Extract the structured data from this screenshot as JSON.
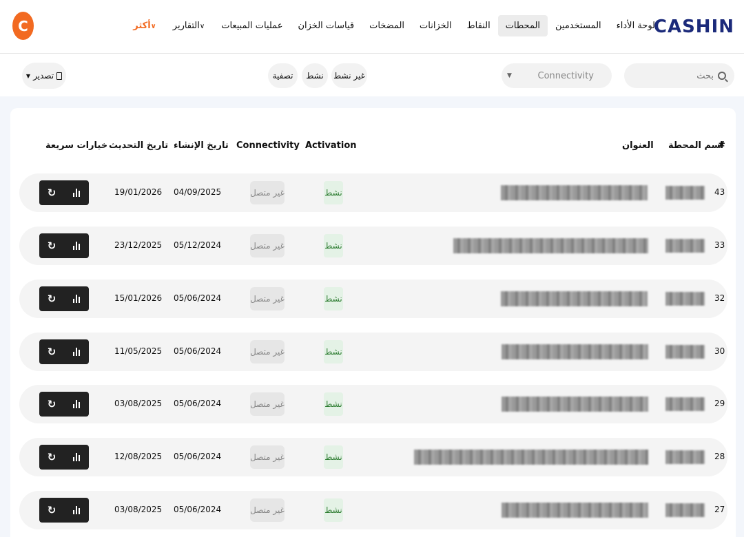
{
  "brand": {
    "logo_text": "CASHIN",
    "badge_letter": "C",
    "accent": "#f26a21",
    "logo_color": "#1b2a7a"
  },
  "nav": {
    "dashboard": "لوحة الأداء",
    "users": "المستخدمين",
    "stations": "المحطات",
    "points": "النقاط",
    "tanks": "الخزانات",
    "pumps": "المضخات",
    "tank_gauges": "قياسات الخزان",
    "sales_ops": "عمليات المبيعات",
    "reports": "التقارير",
    "more": "أكثر"
  },
  "filters": {
    "search_placeholder": "بحث",
    "connectivity_placeholder": "Connectivity",
    "chip_inactive": "غير نشط",
    "chip_active": "نشط",
    "chip_filter": "تصفية",
    "export_label": "تصدير"
  },
  "table": {
    "headers": {
      "index": "#",
      "name": "اسم المحطة",
      "address": "العنوان",
      "activation": "Activation",
      "connectivity": "Connectivity",
      "created": "تاريخ الإنشاء",
      "updated": "تاريخ التحديث",
      "quick": "خيارات سريعة"
    },
    "status_active": "نشط",
    "status_offline": "غير متصل",
    "rows": [
      {
        "id": "43",
        "created": "04/09/2025",
        "updated": "19/01/2026"
      },
      {
        "id": "33",
        "created": "05/12/2024",
        "updated": "23/12/2025"
      },
      {
        "id": "32",
        "created": "05/06/2024",
        "updated": "15/01/2026"
      },
      {
        "id": "30",
        "created": "05/06/2024",
        "updated": "11/05/2025"
      },
      {
        "id": "29",
        "created": "05/06/2024",
        "updated": "03/08/2025"
      },
      {
        "id": "28",
        "created": "05/06/2024",
        "updated": "12/08/2025"
      },
      {
        "id": "27",
        "created": "05/06/2024",
        "updated": "03/08/2025"
      }
    ]
  }
}
